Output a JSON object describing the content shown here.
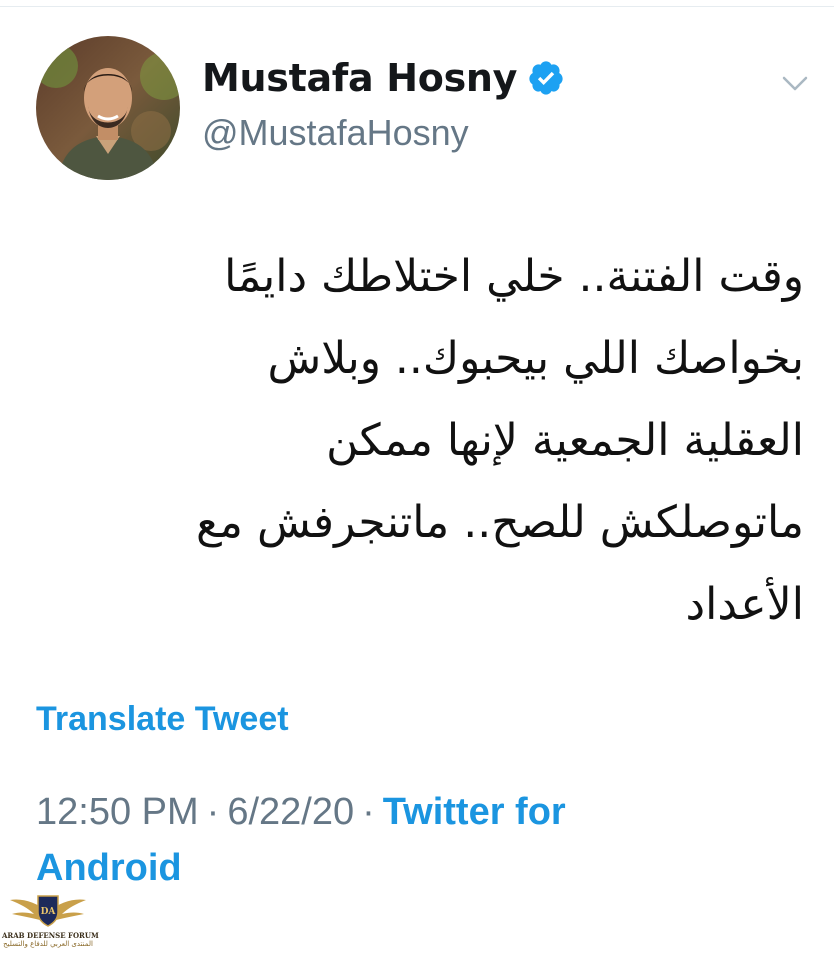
{
  "profile": {
    "display_name": "Mustafa Hosny",
    "handle": "@MustafaHosny",
    "verified": true
  },
  "tweet": {
    "lines": [
      "وقت الفتنة.. خلي اختلاطك دايمًا",
      "بخواصك اللي بيحبوك.. وبلاش",
      "العقلية الجمعية لإنها ممكن",
      "ماتوصلكش للصح.. ماتنجرفش مع",
      "الأعداد"
    ],
    "translate_label": "Translate Tweet",
    "time": "12:50 PM",
    "date": "6/22/20",
    "separator": "·",
    "source_line1": "Twitter for",
    "source_line2": "Android"
  },
  "watermark": {
    "badge": "DA",
    "title": "ARAB DEFENSE FORUM",
    "subtitle": "المنتدى العربي للدفاع والتسليح"
  },
  "icons": {
    "verified": "verified-badge-icon",
    "menu": "chevron-down-icon"
  },
  "colors": {
    "link": "#1b95e0",
    "secondary_text": "#657786",
    "verified": "#1da1f2"
  }
}
